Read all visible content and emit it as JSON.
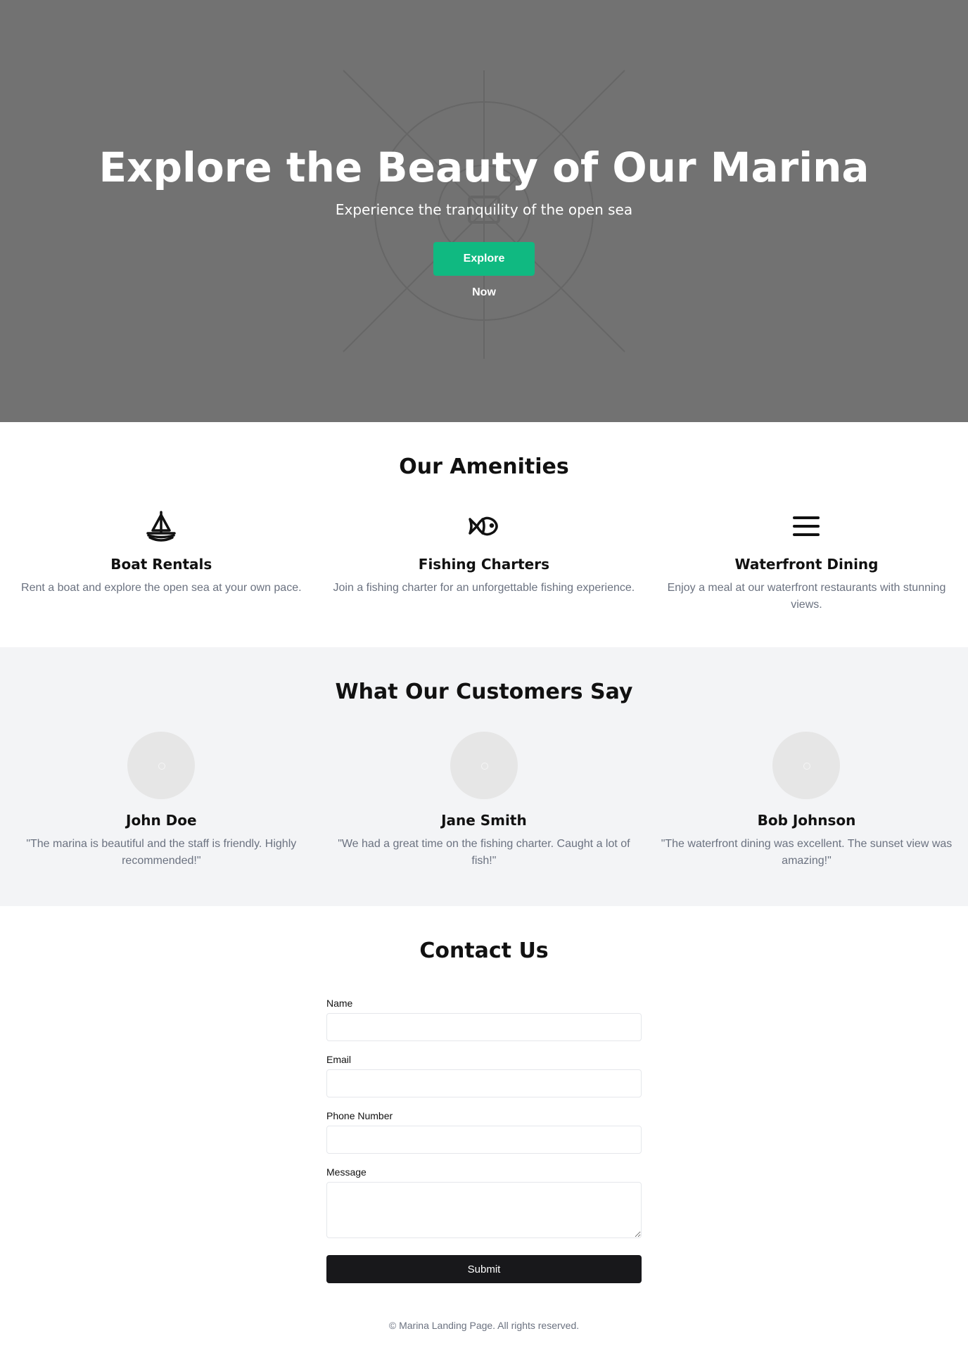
{
  "hero": {
    "title": "Explore the Beauty of Our Marina",
    "subtitle": "Experience the tranquility of the open sea",
    "button_label": "Explore Now"
  },
  "amenities": {
    "title": "Our Amenities",
    "items": [
      {
        "icon": "sailboat-icon",
        "title": "Boat Rentals",
        "text": "Rent a boat and explore the open sea at your own pace."
      },
      {
        "icon": "fish-icon",
        "title": "Fishing Charters",
        "text": "Join a fishing charter for an unforgettable fishing experience."
      },
      {
        "icon": "menu-icon",
        "title": "Waterfront Dining",
        "text": "Enjoy a meal at our waterfront restaurants with stunning views."
      }
    ]
  },
  "testimonials": {
    "title": "What Our Customers Say",
    "items": [
      {
        "name": "John Doe",
        "quote": "\"The marina is beautiful and the staff is friendly. Highly recommended!\""
      },
      {
        "name": "Jane Smith",
        "quote": "\"We had a great time on the fishing charter. Caught a lot of fish!\""
      },
      {
        "name": "Bob Johnson",
        "quote": "\"The waterfront dining was excellent. The sunset view was amazing!\""
      }
    ]
  },
  "contact": {
    "title": "Contact Us",
    "name_label": "Name",
    "email_label": "Email",
    "phone_label": "Phone Number",
    "message_label": "Message",
    "submit_label": "Submit"
  },
  "footer": {
    "text": "© Marina Landing Page. All rights reserved."
  },
  "colors": {
    "hero_bg": "#727272",
    "accent": "#10b981",
    "testimonials_bg": "#f3f4f6",
    "submit_bg": "#18181b"
  }
}
